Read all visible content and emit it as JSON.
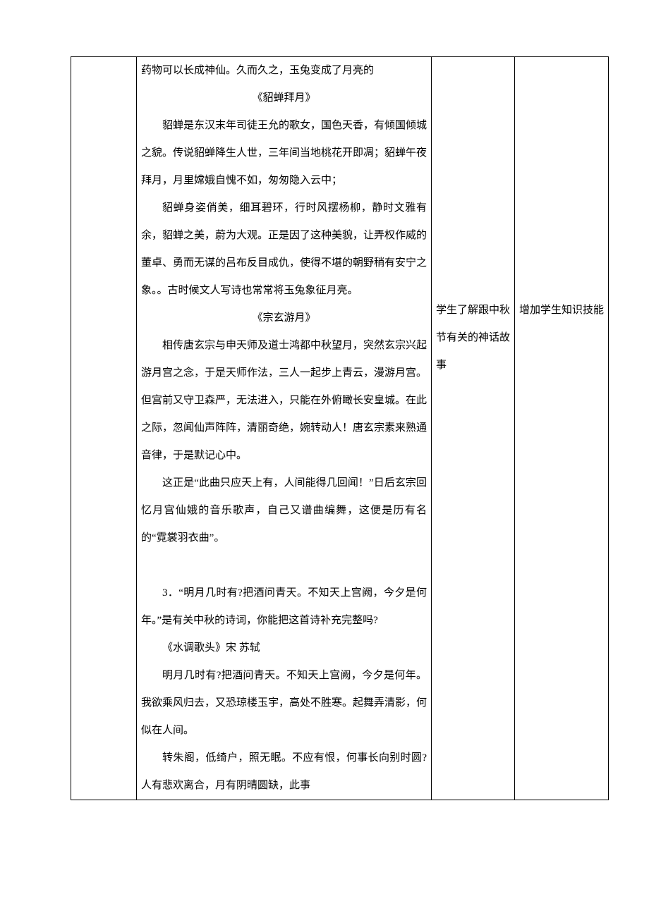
{
  "col1": {
    "p0": "药物可以长成神仙。久而久之，玉兔变成了月亮的",
    "t1": "《貂蝉拜月》",
    "p2": "貂蝉是东汉末年司徒王允的歌女，国色天香，有倾国倾城之貌。传说貂蝉降生人世，三年间当地桃花开即凋；貂蝉午夜拜月，月里嫦娥自愧不如，匆匆隐入云中；",
    "p3": "貂蝉身姿俏美，细耳碧环，行时风摆杨柳，静时文雅有余，貂蝉之美，蔚为大观。正是因了这种美貌，让弄权作威的董卓、勇而无谋的吕布反目成仇，使得不堪的朝野稍有安宁之象。。古时候文人写诗也常常将玉兔象征月亮。",
    "t4": "《宗玄游月》",
    "p5": "相传唐玄宗与申天师及道士鸿都中秋望月，突然玄宗兴起游月宫之念，于是天师作法，三人一起步上青云，漫游月宫。但宫前又守卫森严，无法进入，只能在外俯瞰长安皇城。在此之际，忽闻仙声阵阵，清丽奇绝，婉转动人！唐玄宗素来熟通音律，于是默记心中。",
    "p6": "这正是“此曲只应天上有，人间能得几回闻！”日后玄宗回忆月宫仙娥的音乐歌声，自己又谱曲编舞，这便是历有名的“霓裳羽衣曲”。",
    "p7": "3．“明月几时有?把酒问青天。不知天上宫阙，今夕是何年。”是有关中秋的诗词，你能把这首诗补充完整吗?",
    "p8": "《水调歌头》宋 苏轼",
    "p9": "明月几时有?把酒问青天。不知天上宫阙，今夕是何年。我欲乘风归去，又恐琼楼玉宇，高处不胜寒。起舞弄清影，何似在人间。",
    "p10": "转朱阁，低绮户，照无眠。不应有恨，何事长向别时圆?人有悲欢离合，月有阴晴圆缺，此事"
  },
  "col2": {
    "text": "学生了解跟中秋节有关的神话故事"
  },
  "col3": {
    "text": "增加学生知识技能"
  }
}
